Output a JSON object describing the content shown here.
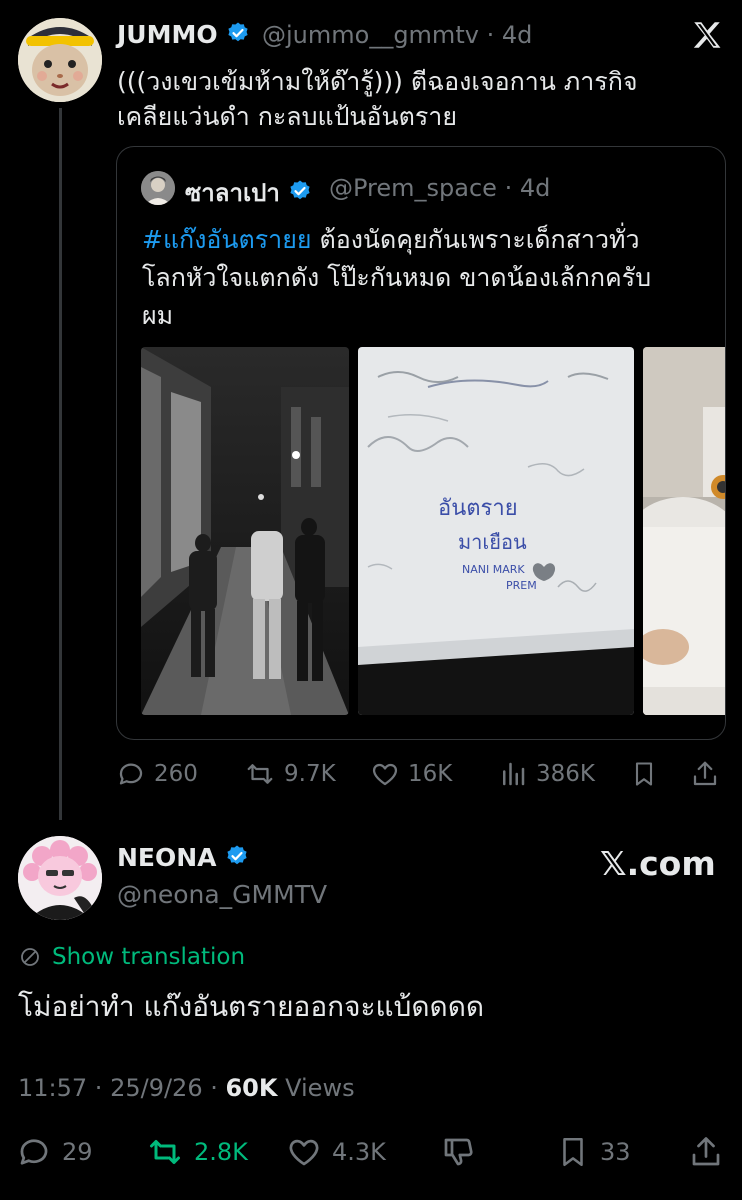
{
  "parent_tweet": {
    "author_name": "JUMMO",
    "handle": "@jummo__gmmtv",
    "age": "4d",
    "text_line1": "(((วงเขวเข้มห้ามให้ด๊ารู้))) ตีฉองเจอกาน ภารกิจ",
    "text_line2": "เคลียแว่นดำ กะลบแป้นอันตราย",
    "quote": {
      "author_name": "ซาลาเปา",
      "handle": "@Prem_space",
      "age": "4d",
      "hashtag": "#แก๊งอันตรายย",
      "text_line1_rest": " ต้องนัดคุยกันเพราะเด็กสาวทั่ว",
      "text_line2": "โลกหัวใจแตกดัง โป๊ะกันหมด ขาดน้องเล้กกครับ",
      "text_line3": "ผม",
      "whiteboard_text": [
        "อันตราย",
        "มาเยือน",
        "NANI MARK",
        "PREM"
      ]
    },
    "stats": {
      "replies": "260",
      "reposts": "9.7K",
      "likes": "16K",
      "views": "386K"
    }
  },
  "main_tweet": {
    "brand": "𝕏.com",
    "author_name": "NEONA",
    "handle": "@neona_GMMTV",
    "translate_label": "Show translation",
    "text": "โม่อย่าทำ แก๊งอันตรายออกจะแบ้ดดดด",
    "time": "11:57",
    "date": "25/9/26",
    "views_count": "60K",
    "views_label": "Views",
    "stats": {
      "replies": "29",
      "reposts": "2.8K",
      "likes": "4.3K",
      "bookmarks": "33"
    }
  },
  "colors": {
    "background": "#000000",
    "text": "#e7e9ea",
    "muted": "#71767b",
    "accent_blue": "#1d9bf0",
    "repost_green": "#00ba7c",
    "border": "#333639"
  },
  "icons": [
    "x-logo-icon",
    "verified-badge-icon",
    "reply-icon",
    "repost-icon",
    "like-icon",
    "views-icon",
    "bookmark-icon",
    "share-icon",
    "translate-globe-icon",
    "dislike-icon"
  ]
}
